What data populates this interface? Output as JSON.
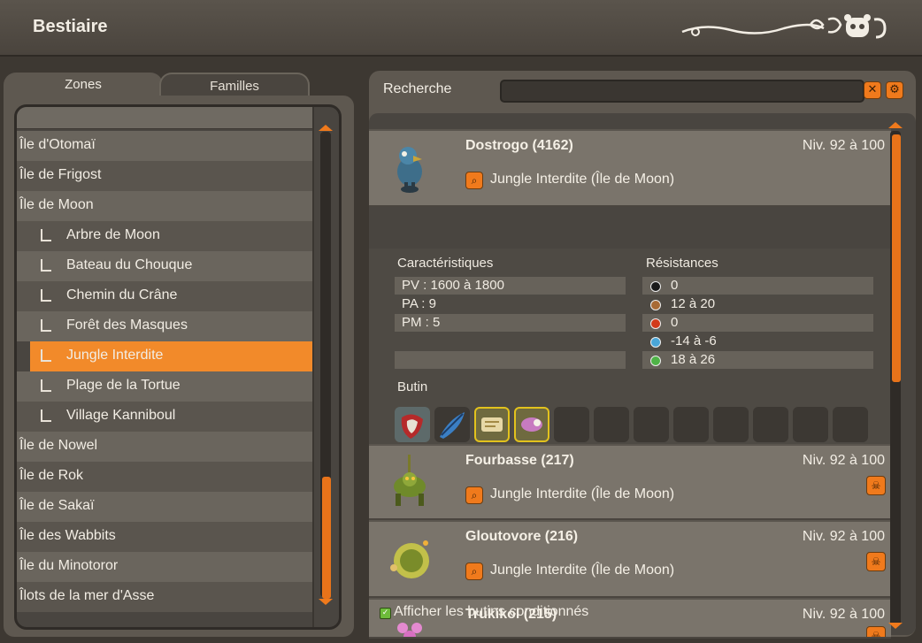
{
  "window": {
    "title": "Bestiaire"
  },
  "tabs": [
    {
      "label": "Zones",
      "active": true
    },
    {
      "label": "Familles",
      "active": false
    }
  ],
  "zones": [
    {
      "label": "Île d'Otomaï",
      "sub": false
    },
    {
      "label": "Île de Frigost",
      "sub": false
    },
    {
      "label": "Île de Moon",
      "sub": false
    },
    {
      "label": "Arbre de Moon",
      "sub": true
    },
    {
      "label": "Bateau du Chouque",
      "sub": true
    },
    {
      "label": "Chemin du Crâne",
      "sub": true
    },
    {
      "label": "Forêt des Masques",
      "sub": true
    },
    {
      "label": "Jungle Interdite",
      "sub": true,
      "selected": true
    },
    {
      "label": "Plage de la Tortue",
      "sub": true
    },
    {
      "label": "Village Kanniboul",
      "sub": true
    },
    {
      "label": "Île de Nowel",
      "sub": false
    },
    {
      "label": "Île de Rok",
      "sub": false
    },
    {
      "label": "Île de Sakaï",
      "sub": false
    },
    {
      "label": "Île des Wabbits",
      "sub": false
    },
    {
      "label": "Île du Minotoror",
      "sub": false
    },
    {
      "label": "Îlots de la mer d'Asse",
      "sub": false
    }
  ],
  "search": {
    "label": "Recherche",
    "value": ""
  },
  "monsters": [
    {
      "name": "Dostrogo (4162)",
      "level": "Niv. 92 à 100",
      "location": "Jungle Interdite (Île de Moon)"
    },
    {
      "name": "Fourbasse (217)",
      "level": "Niv. 92 à 100",
      "location": "Jungle Interdite (Île de Moon)"
    },
    {
      "name": "Gloutovore (216)",
      "level": "Niv. 92 à 100",
      "location": "Jungle Interdite (Île de Moon)"
    },
    {
      "name": "Trukikol (215)",
      "level": "Niv. 92 à 100",
      "location": ""
    }
  ],
  "details": {
    "characteristics_title": "Caractéristiques",
    "characteristics": [
      "PV : 1600 à 1800",
      "PA : 9",
      "PM : 5"
    ],
    "resistances_title": "Résistances",
    "resistances": [
      {
        "value": "0",
        "color": "#1a1a1a"
      },
      {
        "value": "12 à 20",
        "color": "#a86a35"
      },
      {
        "value": "0",
        "color": "#d23a1a"
      },
      {
        "value": "-14 à -6",
        "color": "#4aa6d8"
      },
      {
        "value": "18 à 26",
        "color": "#4fb347"
      }
    ],
    "loot_title": "Butin"
  },
  "footer": {
    "checkbox_label": "Afficher les butins conditionnés",
    "checked": true
  },
  "colors": {
    "accent": "#f07a1c",
    "panel": "#5e5850",
    "selected": "#f28a2a"
  }
}
